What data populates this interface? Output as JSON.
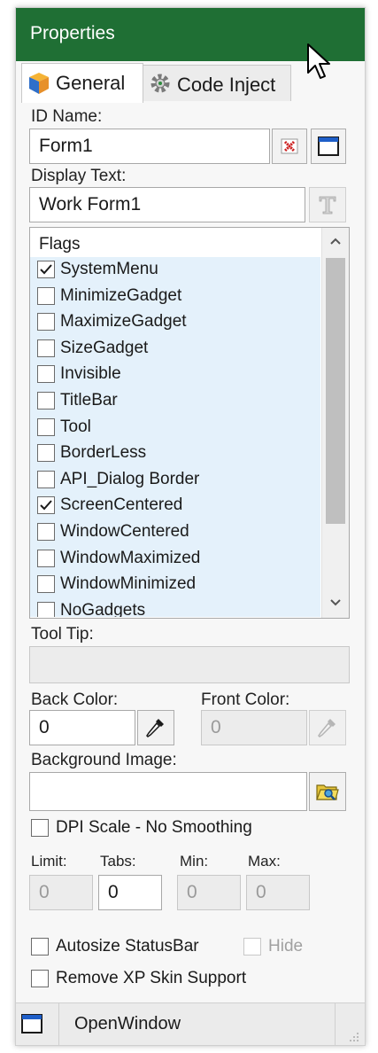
{
  "window": {
    "title": "Properties"
  },
  "tabs": [
    {
      "label": "General",
      "icon": "cube-icon"
    },
    {
      "label": "Code Inject",
      "icon": "gear-icon"
    }
  ],
  "id_name": {
    "label": "ID Name:",
    "value": "Form1"
  },
  "display_text": {
    "label": "Display Text:",
    "value": "Work Form1"
  },
  "flags": {
    "header": "Flags",
    "items": [
      {
        "label": "SystemMenu",
        "checked": true
      },
      {
        "label": "MinimizeGadget",
        "checked": false
      },
      {
        "label": "MaximizeGadget",
        "checked": false
      },
      {
        "label": "SizeGadget",
        "checked": false
      },
      {
        "label": "Invisible",
        "checked": false
      },
      {
        "label": "TitleBar",
        "checked": false
      },
      {
        "label": "Tool",
        "checked": false
      },
      {
        "label": "BorderLess",
        "checked": false
      },
      {
        "label": "API_Dialog Border",
        "checked": false
      },
      {
        "label": "ScreenCentered",
        "checked": true
      },
      {
        "label": "WindowCentered",
        "checked": false
      },
      {
        "label": "WindowMaximized",
        "checked": false
      },
      {
        "label": "WindowMinimized",
        "checked": false
      },
      {
        "label": "NoGadgets",
        "checked": false
      }
    ]
  },
  "tooltip": {
    "label": "Tool Tip:",
    "value": ""
  },
  "back_color": {
    "label": "Back Color:",
    "value": "0"
  },
  "front_color": {
    "label": "Front Color:",
    "value": "0"
  },
  "background_image": {
    "label": "Background Image:",
    "value": ""
  },
  "dpi_scale": {
    "label": "DPI Scale - No Smoothing",
    "checked": false
  },
  "limits": {
    "limit": {
      "label": "Limit:",
      "value": "0"
    },
    "tabs": {
      "label": "Tabs:",
      "value": "0"
    },
    "min": {
      "label": "Min:",
      "value": "0"
    },
    "max": {
      "label": "Max:",
      "value": "0"
    }
  },
  "autosize_statusbar": {
    "label": "Autosize StatusBar",
    "checked": false
  },
  "hide": {
    "label": "Hide",
    "checked": false
  },
  "remove_xp_skin": {
    "label": "Remove XP Skin Support",
    "checked": false
  },
  "statusbar": {
    "label": "OpenWindow",
    "icon": "window-icon"
  },
  "colors": {
    "titlebar": "#1f6f34",
    "list_bg": "#e4f1fb"
  }
}
